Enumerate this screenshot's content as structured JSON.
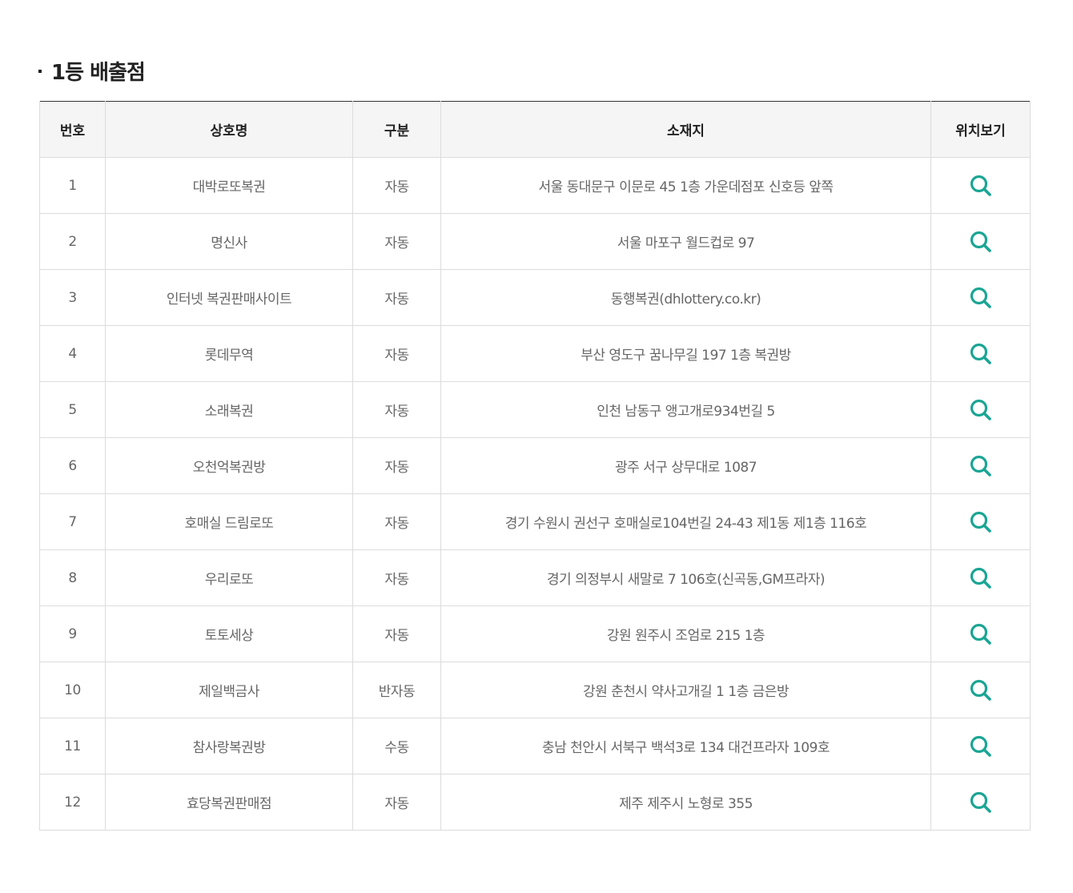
{
  "section": {
    "title": "1등 배출점"
  },
  "table": {
    "headers": {
      "no": "번호",
      "name": "상호명",
      "type": "구분",
      "address": "소재지",
      "location": "위치보기"
    },
    "rows": [
      {
        "no": "1",
        "name": "대박로또복권",
        "type": "자동",
        "address": "서울 동대문구 이문로 45 1층 가운데점포 신호등 앞쪽"
      },
      {
        "no": "2",
        "name": "명신사",
        "type": "자동",
        "address": "서울 마포구 월드컵로 97"
      },
      {
        "no": "3",
        "name": "인터넷 복권판매사이트",
        "type": "자동",
        "address": "동행복권(dhlottery.co.kr)"
      },
      {
        "no": "4",
        "name": "롯데무역",
        "type": "자동",
        "address": "부산 영도구 꿈나무길 197 1층 복권방"
      },
      {
        "no": "5",
        "name": "소래복권",
        "type": "자동",
        "address": "인천 남동구 앵고개로934번길 5"
      },
      {
        "no": "6",
        "name": "오천억복권방",
        "type": "자동",
        "address": "광주 서구 상무대로 1087"
      },
      {
        "no": "7",
        "name": "호매실 드림로또",
        "type": "자동",
        "address": "경기 수원시 권선구 호매실로104번길 24-43 제1동 제1층 116호"
      },
      {
        "no": "8",
        "name": "우리로또",
        "type": "자동",
        "address": "경기 의정부시 새말로 7 106호(신곡동,GM프라자)"
      },
      {
        "no": "9",
        "name": "토토세상",
        "type": "자동",
        "address": "강원 원주시 조엄로 215 1층"
      },
      {
        "no": "10",
        "name": "제일백금사",
        "type": "반자동",
        "address": "강원 춘천시 약사고개길 1 1층 금은방"
      },
      {
        "no": "11",
        "name": "참사랑복권방",
        "type": "수동",
        "address": "충남 천안시 서북구 백석3로 134 대건프라자 109호"
      },
      {
        "no": "12",
        "name": "효당복권판매점",
        "type": "자동",
        "address": "제주 제주시 노형로 355"
      }
    ]
  },
  "icons": {
    "location": "search-icon"
  },
  "colors": {
    "icon": "#1ba594",
    "header_bg": "#f5f5f5",
    "border": "#dcdcdc",
    "top_border": "#333333"
  }
}
